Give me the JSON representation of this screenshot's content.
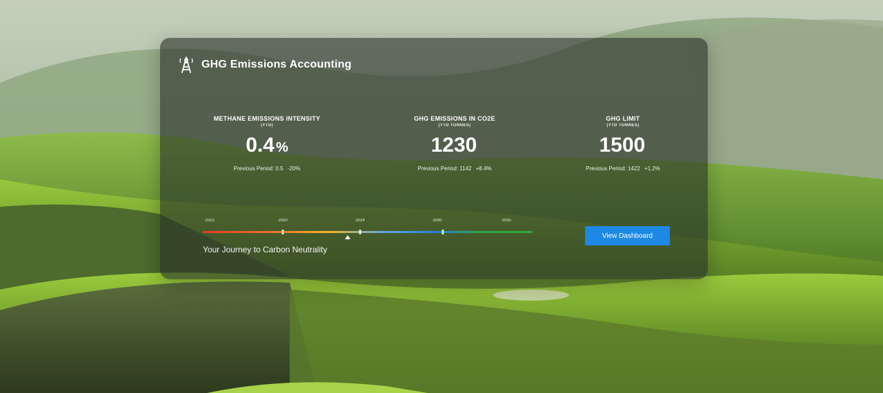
{
  "header": {
    "title": "GHG Emissions Accounting",
    "logo_icon": "tower-icon"
  },
  "metrics": [
    {
      "label": "METHANE EMISSIONS INTENSITY",
      "sub": "(YTD)",
      "value": "0.4",
      "unit": "%",
      "prev_label": "Previous Period: 0.5",
      "prev_change": "-20%"
    },
    {
      "label": "GHG EMISSIONS IN CO2e",
      "sub": "(YTD TONNES)",
      "value": "1230",
      "unit": "",
      "prev_label": "Previous Period: 1142",
      "prev_change": "+8.4%"
    },
    {
      "label": "GHG LIMIT",
      "sub": "(YTD TONNES)",
      "value": "1500",
      "unit": "",
      "prev_label": "Previous Period: 1422",
      "prev_change": "+1.2%"
    }
  ],
  "timeline": {
    "years": [
      "2015",
      "2020",
      "2024",
      "2030",
      "2035"
    ],
    "current_year": "2024",
    "progress": 0.44,
    "label": "Your Journey to Carbon Neutrality",
    "gradient_colors": [
      "#e63a2a",
      "#f07b28",
      "#f5b62a",
      "#2a7fe0",
      "#2faa3a"
    ]
  },
  "actions": {
    "view_dashboard_label": "View Dashboard",
    "button_color": "#1e88e5"
  }
}
